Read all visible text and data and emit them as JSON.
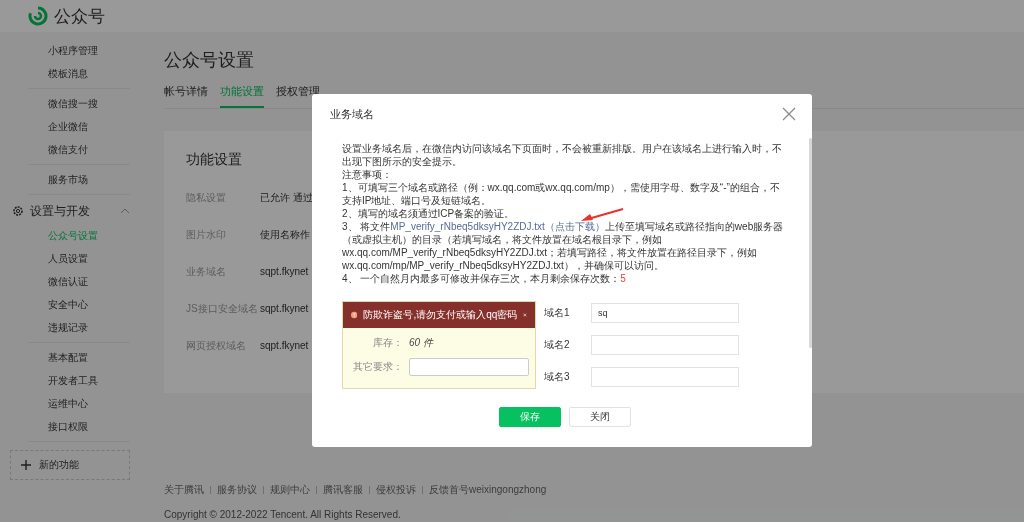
{
  "header": {
    "title": "公众号"
  },
  "sidebar": {
    "groups": [
      {
        "items": [
          {
            "label": "小程序管理",
            "selected": false
          },
          {
            "label": "模板消息",
            "selected": false
          }
        ]
      },
      {
        "items": [
          {
            "label": "微信搜一搜",
            "selected": false
          },
          {
            "label": "企业微信",
            "selected": false
          },
          {
            "label": "微信支付",
            "selected": false
          }
        ]
      },
      {
        "items": [
          {
            "label": "服务市场",
            "selected": false
          }
        ]
      },
      {
        "title": "设置与开发",
        "expanded": true,
        "items": [
          {
            "label": "公众号设置",
            "selected": true
          },
          {
            "label": "人员设置",
            "selected": false
          },
          {
            "label": "微信认证",
            "selected": false
          },
          {
            "label": "安全中心",
            "selected": false
          },
          {
            "label": "违规记录",
            "selected": false
          }
        ]
      },
      {
        "items": [
          {
            "label": "基本配置",
            "selected": false
          },
          {
            "label": "开发者工具",
            "selected": false
          },
          {
            "label": "运维中心",
            "selected": false
          },
          {
            "label": "接口权限",
            "selected": false
          }
        ]
      }
    ],
    "new_feature": "新的功能"
  },
  "page": {
    "title": "公众号设置",
    "tabs": [
      {
        "label": "帐号详情",
        "selected": false
      },
      {
        "label": "功能设置",
        "selected": true
      },
      {
        "label": "授权管理",
        "selected": false
      }
    ]
  },
  "card": {
    "title": "功能设置",
    "rows": [
      {
        "label": "隐私设置",
        "value": "已允许 通过"
      },
      {
        "label": "图片水印",
        "value": "使用名称作"
      },
      {
        "label": "业务域名",
        "value": "sqpt.fkynet"
      },
      {
        "label": "JS接口安全域名",
        "value": "sqpt.fkynet"
      },
      {
        "label": "网页授权域名",
        "value": "sqpt.fkynet"
      }
    ]
  },
  "footer": {
    "links": [
      "关于腾讯",
      "服务协议",
      "规则中心",
      "腾讯客服",
      "侵权投诉",
      "反馈首号weixingongzhong"
    ],
    "copyright": "Copyright © 2012-2022 Tencent. All Rights Reserved."
  },
  "dialog": {
    "title": "业务域名",
    "intro": "设置业务域名后，在微信内访问该域名下页面时，不会被重新排版。用户在该域名上进行输入时，不出现下图所示的安全提示。",
    "notes_title": "注意事项：",
    "notes": [
      [
        {
          "kind": "text",
          "text": "1、可填写三个域名或路径（例：wx.qq.com或wx.qq.com/mp），需使用字母、数字及“-”的组合，不支持IP地址、端口号及短链域名。"
        }
      ],
      [
        {
          "kind": "text",
          "text": "2、填写的域名须通过ICP备案的验证。"
        }
      ],
      [
        {
          "kind": "text",
          "text": "3、 将文件"
        },
        {
          "kind": "link",
          "text": "MP_verify_rNbeq5dksyHY2ZDJ.txt（点击下载）"
        },
        {
          "kind": "text",
          "text": "上传至填写域名或路径指向的web服务器（或虚拟主机）的目录（若填写域名，将文件放置在域名根目录下，例如wx.qq.com/MP_verify_rNbeq5dksyHY2ZDJ.txt；若填写路径，将文件放置在路径目录下，例如wx.qq.com/mp/MP_verify_rNbeq5dksyHY2ZDJ.txt），并确保可以访问。"
        }
      ],
      [
        {
          "kind": "text",
          "text": "4、 一个自然月内最多可修改并保存三次，本月剩余保存次数："
        },
        {
          "kind": "count",
          "text": "5"
        }
      ]
    ],
    "example": {
      "alert": "防欺诈盗号,请勿支付或输入qq密码",
      "rows": [
        {
          "kind": "text",
          "label": "库存：",
          "value": "60 件"
        },
        {
          "kind": "input",
          "label": "其它要求："
        }
      ]
    },
    "fields": [
      {
        "label": "域名1",
        "value": "sq"
      },
      {
        "label": "域名2"
      },
      {
        "label": "域名3"
      }
    ],
    "buttons": [
      {
        "label": "保存",
        "kind": "primary"
      },
      {
        "label": "关闭",
        "kind": "default"
      }
    ]
  }
}
